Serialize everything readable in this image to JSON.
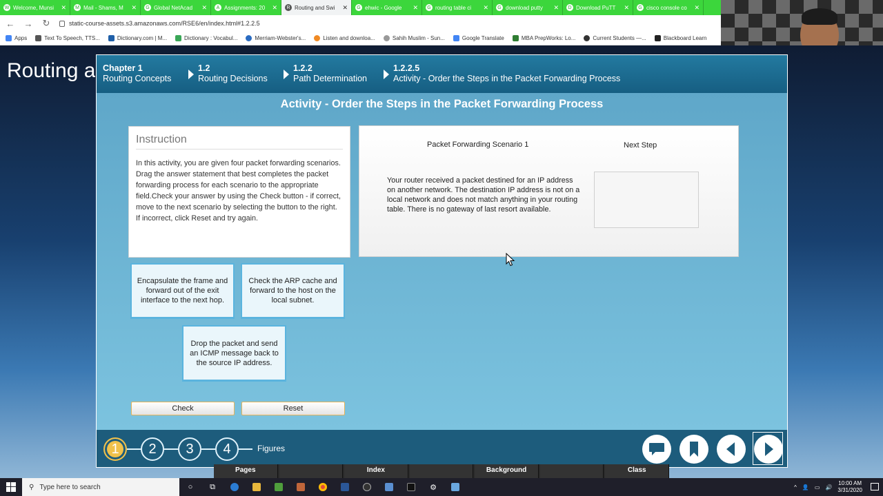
{
  "browser": {
    "tabs": [
      {
        "label": "Welcome, Munsi",
        "fav": "W"
      },
      {
        "label": "Mail - Shams, M",
        "fav": "M"
      },
      {
        "label": "Global NetAcad",
        "fav": "G"
      },
      {
        "label": "Assignments: 20",
        "fav": "A"
      },
      {
        "label": "Routing and Swi",
        "fav": "R"
      },
      {
        "label": "ehwic - Google",
        "fav": "G"
      },
      {
        "label": "routing table ci",
        "fav": "G"
      },
      {
        "label": "download putty",
        "fav": "G"
      },
      {
        "label": "Download PuTT",
        "fav": "D"
      },
      {
        "label": "cisco console co",
        "fav": "G"
      }
    ],
    "active_tab_index": 4,
    "url": "static-course-assets.s3.amazonaws.com/RSE6/en/index.html#1.2.2.5",
    "bookmarks": [
      {
        "label": "Apps",
        "color": "#4285f4"
      },
      {
        "label": "Text To Speech, TTS...",
        "color": "#555555"
      },
      {
        "label": "Dictionary.com | M...",
        "color": "#1f5fa8"
      },
      {
        "label": "Dictionary : Vocabul...",
        "color": "#3aa757"
      },
      {
        "label": "Merriam-Webster's...",
        "color": "#2a6bc1"
      },
      {
        "label": "Listen and downloa...",
        "color": "#f08a24"
      },
      {
        "label": "Sahih Muslim - Sun...",
        "color": "#999999"
      },
      {
        "label": "Google Translate",
        "color": "#4285f4"
      },
      {
        "label": "MBA PrepWorks: Lo...",
        "color": "#2f7d32"
      },
      {
        "label": "Current Students —...",
        "color": "#333333"
      },
      {
        "label": "Blackboard Learn",
        "color": "#222222"
      }
    ]
  },
  "desktop": {
    "background_title": "Routing and"
  },
  "course": {
    "breadcrumbs": [
      {
        "num": "Chapter 1",
        "label": "Routing Concepts"
      },
      {
        "num": "1.2",
        "label": "Routing Decisions"
      },
      {
        "num": "1.2.2",
        "label": "Path Determination"
      },
      {
        "num": "1.2.2.5",
        "label": "Activity - Order the Steps in the Packet Forwarding Process"
      }
    ],
    "activity_title": "Activity - Order the Steps in the Packet Forwarding Process",
    "instruction": {
      "heading": "Instruction",
      "text": "In this activity, you are given four packet forwarding scenarios. Drag the answer statement that best completes the packet forwarding process for each scenario to the appropriate field.Check your answer by using the Check button - if correct, move to the next scenario by selecting the button to the right. If incorrect, click Reset and try again."
    },
    "scenario": {
      "title": "Packet Forwarding Scenario 1",
      "next_step_label": "Next Step",
      "text": "Your router received a packet destined for an IP address on another network. The destination IP address is not on a local network and does not match anything in your routing table. There is no gateway of last resort available."
    },
    "answers": {
      "encapsulate": "Encapsulate the frame and forward out of the exit interface to the next hop.",
      "arp": "Check the ARP cache and forward to the host on the local subnet.",
      "drop": "Drop the packet and send an ICMP message back to the source IP address."
    },
    "buttons": {
      "check": "Check",
      "reset": "Reset"
    },
    "footer": {
      "steps": [
        "1",
        "2",
        "3",
        "4"
      ],
      "current_step": 1,
      "figures_label": "Figures"
    },
    "colors": {
      "header": "#1b6c92",
      "footer": "#1d5c7c",
      "accent": "#f0c14b"
    }
  },
  "below_strip": [
    "Pages",
    "",
    "Index",
    "",
    "Background",
    "",
    "Class"
  ],
  "taskbar": {
    "search_placeholder": "Type here to search",
    "time": "10:00 AM",
    "date": "3/31/2020"
  }
}
